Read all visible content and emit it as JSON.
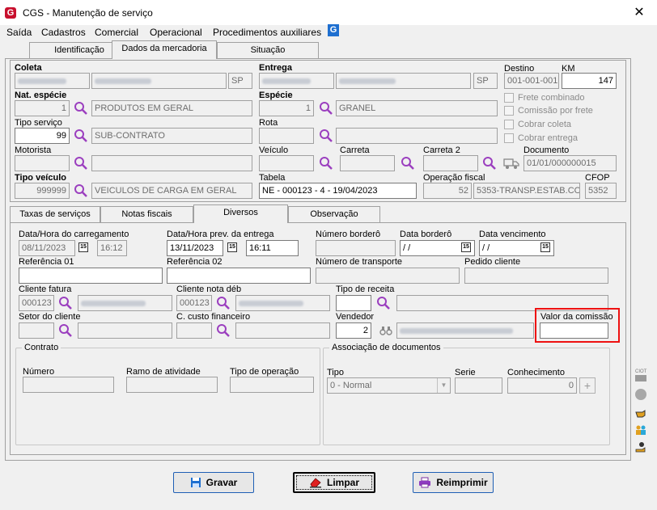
{
  "window": {
    "title": "CGS - Manutenção de serviço",
    "close_glyph": "✕"
  },
  "menu": [
    "Saída",
    "Cadastros",
    "Comercial",
    "Operacional",
    "Procedimentos auxiliares"
  ],
  "tabs_top": [
    "Identificação",
    "Dados da mercadoria",
    "Situação"
  ],
  "header": {
    "coleta": {
      "label": "Coleta",
      "uf": "SP"
    },
    "entrega": {
      "label": "Entrega",
      "uf": "SP"
    },
    "destino": {
      "label": "Destino",
      "value": "001-001-001"
    },
    "km": {
      "label": "KM",
      "value": "147"
    },
    "nat_especie": {
      "label": "Nat. espécie",
      "code": "1",
      "desc": "PRODUTOS EM GERAL"
    },
    "especie": {
      "label": "Espécie",
      "code": "1",
      "desc": "GRANEL"
    },
    "checks": [
      "Frete combinado",
      "Comissão por frete",
      "Cobrar coleta",
      "Cobrar entrega"
    ],
    "tipo_servico": {
      "label": "Tipo serviço",
      "code": "99",
      "desc": "SUB-CONTRATO"
    },
    "rota": {
      "label": "Rota"
    },
    "motorista": {
      "label": "Motorista"
    },
    "veiculo": {
      "label": "Veículo"
    },
    "carreta": {
      "label": "Carreta"
    },
    "carreta2": {
      "label": "Carreta 2"
    },
    "documento": {
      "label": "Documento",
      "value": "01/01/000000015"
    },
    "tipo_veiculo": {
      "label": "Tipo veículo",
      "code": "999999",
      "desc": "VEICULOS DE CARGA EM GERAL"
    },
    "tabela": {
      "label": "Tabela",
      "value": "NE - 000123 - 4 - 19/04/2023"
    },
    "operacao_fiscal": {
      "label": "Operação fiscal",
      "code": "52",
      "desc": "5353-TRANSP.ESTAB.CO"
    },
    "cfop": {
      "label": "CFOP",
      "value": "5352"
    }
  },
  "tabs_bottom": [
    "Taxas de serviços",
    "Notas fiscais",
    "Diversos",
    "Observação"
  ],
  "diversos": {
    "carregamento": {
      "label": "Data/Hora do carregamento",
      "date": "08/11/2023",
      "time": "16:12"
    },
    "prev_entrega": {
      "label": "Data/Hora prev. da entrega",
      "date": "13/11/2023",
      "time": "16:11"
    },
    "numero_bordero": {
      "label": "Número borderô"
    },
    "data_bordero": {
      "label": "Data borderô",
      "value": " / /"
    },
    "data_vencimento": {
      "label": "Data vencimento",
      "value": " / /"
    },
    "referencia01": {
      "label": "Referência 01"
    },
    "referencia02": {
      "label": "Referência 02"
    },
    "numero_transporte": {
      "label": "Número de transporte"
    },
    "pedido_cliente": {
      "label": "Pedido cliente"
    },
    "cliente_fatura": {
      "label": "Cliente fatura",
      "code": "000123"
    },
    "cliente_nota": {
      "label": "Cliente nota déb",
      "code": "000123"
    },
    "tipo_receita": {
      "label": "Tipo de receita"
    },
    "setor_cliente": {
      "label": "Setor do cliente"
    },
    "custo_financeiro": {
      "label": "C. custo financeiro"
    },
    "vendedor": {
      "label": "Vendedor",
      "value": "2"
    },
    "valor_comissao": {
      "label": "Valor da comissão",
      "value": ""
    },
    "contrato": {
      "title": "Contrato",
      "numero": "Número",
      "ramo": "Ramo de atividade",
      "tipo_op": "Tipo de operação"
    },
    "assoc": {
      "title": "Associação de documentos",
      "tipo": "Tipo",
      "tipo_value": "0 - Normal",
      "serie": "Serie",
      "conhecimento": "Conhecimento",
      "conhecimento_value": "0"
    }
  },
  "side_icons": [
    "ciot-icon",
    "circle-icon",
    "hand-pointer-icon",
    "people-icon",
    "user-hand-icon"
  ],
  "side_icon_label": "CIOT",
  "buttons": {
    "gravar": "Gravar",
    "limpar": "Limpar",
    "reimprimir": "Reimprimir"
  },
  "colors": {
    "accent": "#1f5fb5",
    "highlight": "#e11111",
    "search": "#9b3fbf"
  }
}
